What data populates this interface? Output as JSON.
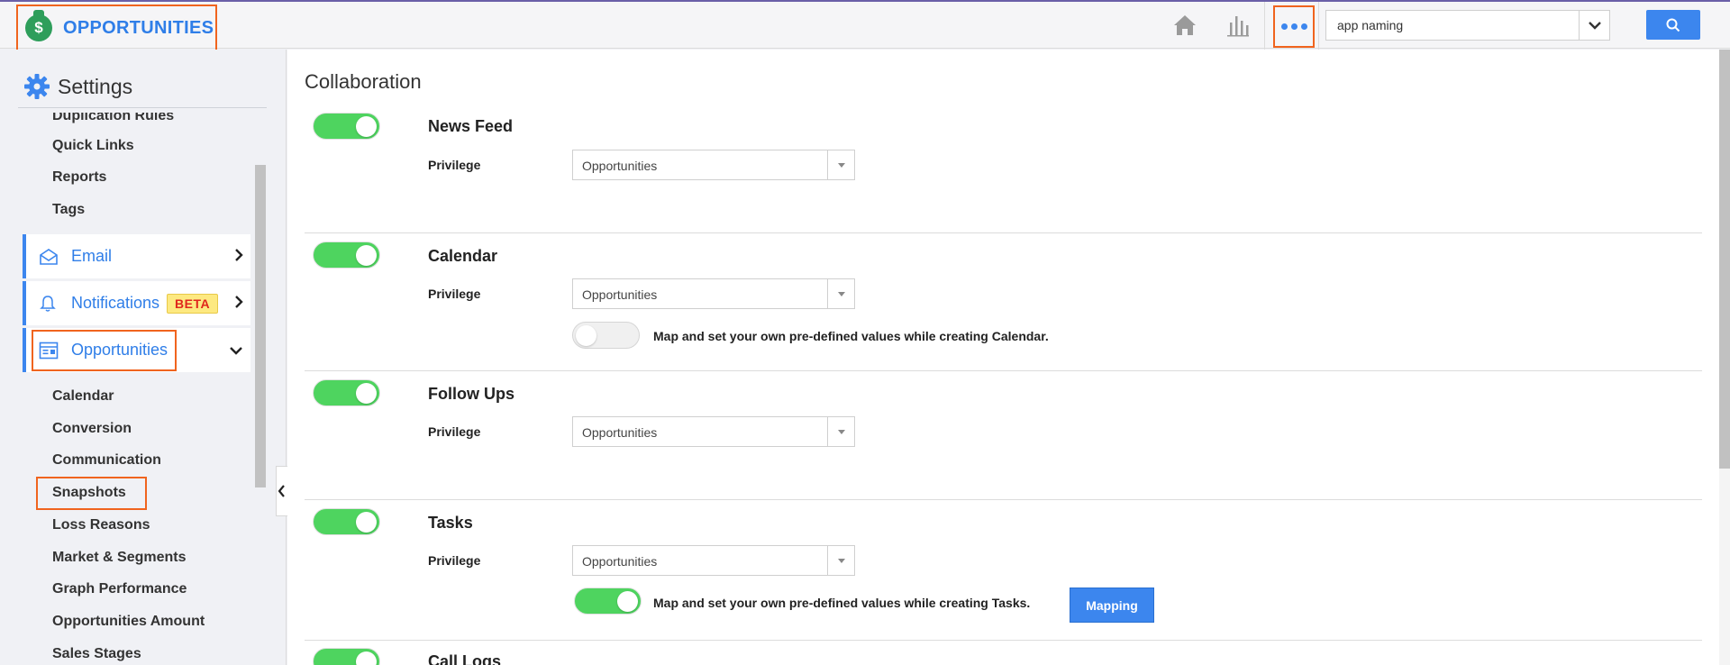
{
  "header": {
    "app_title": "OPPORTUNITIES",
    "brand_symbol": "$",
    "search_value": "app naming"
  },
  "sidebar": {
    "title": "Settings",
    "links_top": [
      "Duplication Rules",
      "Quick Links",
      "Reports",
      "Tags"
    ],
    "categories": [
      {
        "label": "Email"
      },
      {
        "label": "Notifications",
        "badge": "BETA"
      },
      {
        "label": "Opportunities"
      }
    ],
    "sub_links": [
      "Calendar",
      "Conversion",
      "Communication",
      "Snapshots",
      "Loss Reasons",
      "Market & Segments",
      "Graph Performance",
      "Opportunities Amount",
      "Sales Stages"
    ]
  },
  "main": {
    "title": "Collaboration",
    "sections": [
      {
        "title": "News Feed",
        "privilege_label": "Privilege",
        "privilege_value": "Opportunities",
        "enabled": true
      },
      {
        "title": "Calendar",
        "privilege_label": "Privilege",
        "privilege_value": "Opportunities",
        "enabled": true,
        "mapping_text": "Map and set your own pre-defined values while creating Calendar.",
        "mapping_enabled": false
      },
      {
        "title": "Follow Ups",
        "privilege_label": "Privilege",
        "privilege_value": "Opportunities",
        "enabled": true
      },
      {
        "title": "Tasks",
        "privilege_label": "Privilege",
        "privilege_value": "Opportunities",
        "enabled": true,
        "mapping_text": "Map and set your own pre-defined values while creating Tasks.",
        "mapping_enabled": true,
        "mapping_button": "Mapping"
      },
      {
        "title": "Call Logs",
        "enabled": true
      }
    ]
  },
  "colors": {
    "accent_blue": "#3c86ee",
    "highlight_orange": "#f0641e",
    "toggle_green": "#4ed45f",
    "brand_green": "#2e9e5b"
  }
}
